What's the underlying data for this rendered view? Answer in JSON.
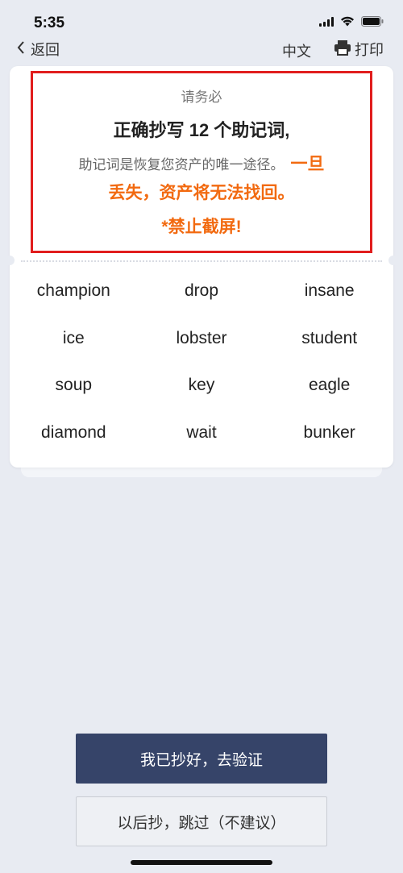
{
  "status_bar": {
    "time": "5:35"
  },
  "nav": {
    "back_label": "返回",
    "language_label": "中文",
    "print_label": "打印"
  },
  "warning": {
    "please": "请务必",
    "title": "正确抄写 12 个助记词,",
    "line3_prefix": "助记词是恢复您资产的唯一途径。",
    "line3_highlight": "一旦",
    "line4": "丢失，资产将无法找回。",
    "line5": "*禁止截屏!"
  },
  "mnemonic_words": [
    "champion",
    "drop",
    "insane",
    "ice",
    "lobster",
    "student",
    "soup",
    "key",
    "eagle",
    "diamond",
    "wait",
    "bunker"
  ],
  "buttons": {
    "primary": "我已抄好，去验证",
    "secondary": "以后抄，跳过（不建议）"
  },
  "colors": {
    "background": "#e8ebf2",
    "warning_border": "#e11d1d",
    "warning_accent": "#f26a10",
    "primary_button": "#364469"
  }
}
